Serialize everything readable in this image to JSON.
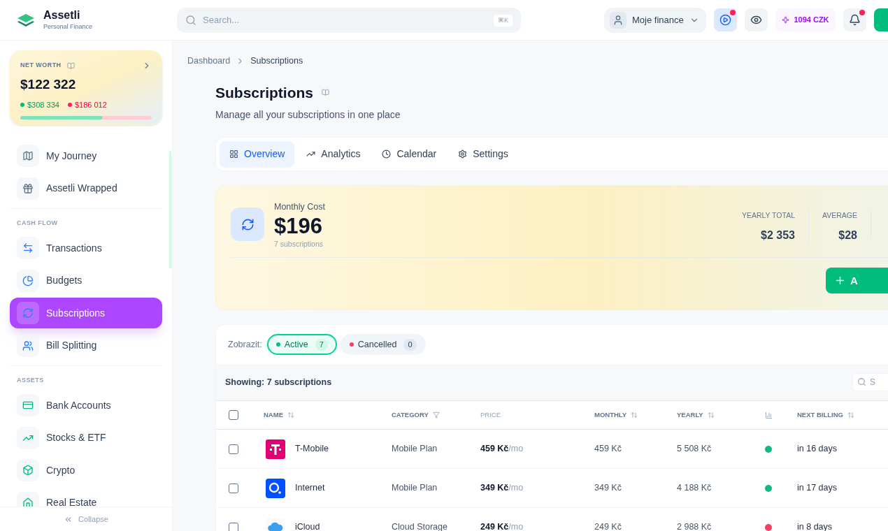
{
  "brand": {
    "name": "Assetli",
    "tagline": "Personal Finance"
  },
  "search": {
    "placeholder": "Search...",
    "shortcut": "⌘K"
  },
  "header": {
    "profile": "Moje finance",
    "credits": "1094 CZK",
    "play_notification": true,
    "bell_notification": true
  },
  "net_worth": {
    "label": "NET WORTH",
    "value": "$122 322",
    "assets": "$308 334",
    "liabilities": "$186 012",
    "level": 0.62
  },
  "sidebar": {
    "sections": [
      {
        "items": [
          {
            "label": "My Journey",
            "selected": false
          },
          {
            "label": "Assetli Wrapped",
            "selected": false
          }
        ]
      },
      {
        "title": "CASH FLOW",
        "items": [
          {
            "label": "Transactions",
            "selected": false
          },
          {
            "label": "Budgets",
            "selected": false
          },
          {
            "label": "Subscriptions",
            "selected": true
          },
          {
            "label": "Bill Splitting",
            "selected": false
          }
        ]
      },
      {
        "title": "ASSETS",
        "items": [
          {
            "label": "Bank Accounts",
            "selected": false
          },
          {
            "label": "Stocks & ETF",
            "selected": false
          },
          {
            "label": "Crypto",
            "selected": false
          },
          {
            "label": "Real Estate",
            "selected": false
          }
        ]
      }
    ],
    "collapse": "Collapse"
  },
  "breadcrumb": [
    "Dashboard",
    "Subscriptions"
  ],
  "page": {
    "title": "Subscriptions",
    "subtitle": "Manage all your subscriptions in one place"
  },
  "tabs": [
    {
      "label": "Overview",
      "selected": true
    },
    {
      "label": "Analytics",
      "selected": false
    },
    {
      "label": "Calendar",
      "selected": false
    },
    {
      "label": "Settings",
      "selected": false
    }
  ],
  "summary": {
    "label": "Monthly Cost",
    "value": "$196",
    "count": "7 subscriptions",
    "stats": [
      {
        "label": "YEARLY TOTAL",
        "value": "$2 353"
      },
      {
        "label": "AVERAGE",
        "value": "$28"
      }
    ],
    "add_button": "A"
  },
  "filter": {
    "label": "Zobrazit:",
    "chips": [
      {
        "label": "Active",
        "count": "7",
        "selected": true,
        "color": "#10b981"
      },
      {
        "label": "Cancelled",
        "count": "0",
        "selected": false,
        "color": "#f43f5e"
      }
    ]
  },
  "table": {
    "showing": "Showing: 7 subscriptions",
    "search_placeholder": "S",
    "all_selected": false,
    "columns": [
      {
        "label": "NAME",
        "kind": "sort"
      },
      {
        "label": "CATEGORY",
        "kind": "filter"
      },
      {
        "label": "PRICE",
        "kind": "plain"
      },
      {
        "label": "MONTHLY",
        "kind": "sort"
      },
      {
        "label": "YEARLY",
        "kind": "sort"
      },
      {
        "kind": "chart"
      },
      {
        "label": "NEXT BILLING",
        "kind": "sort"
      }
    ],
    "rows": [
      {
        "kind": "tmobile",
        "name": "T-Mobile",
        "category": "Mobile Plan",
        "price": "459 Kč",
        "per": "/mo",
        "monthly": "459 Kč",
        "yearly": "5 508 Kč",
        "color": "#10b981",
        "next": "in 16 days",
        "checked": false
      },
      {
        "kind": "o2",
        "name": "Internet",
        "category": "Mobile Plan",
        "price": "349 Kč",
        "per": "/mo",
        "monthly": "349 Kč",
        "yearly": "4 188 Kč",
        "color": "#10b981",
        "next": "in 17 days",
        "checked": false
      },
      {
        "kind": "icloud",
        "name": "iCloud",
        "category": "Cloud Storage",
        "price": "249 Kč",
        "per": "/mo",
        "monthly": "249 Kč",
        "yearly": "2 988 Kč",
        "color": "#f43f5e",
        "next": "in 8 days",
        "checked": false
      }
    ]
  }
}
